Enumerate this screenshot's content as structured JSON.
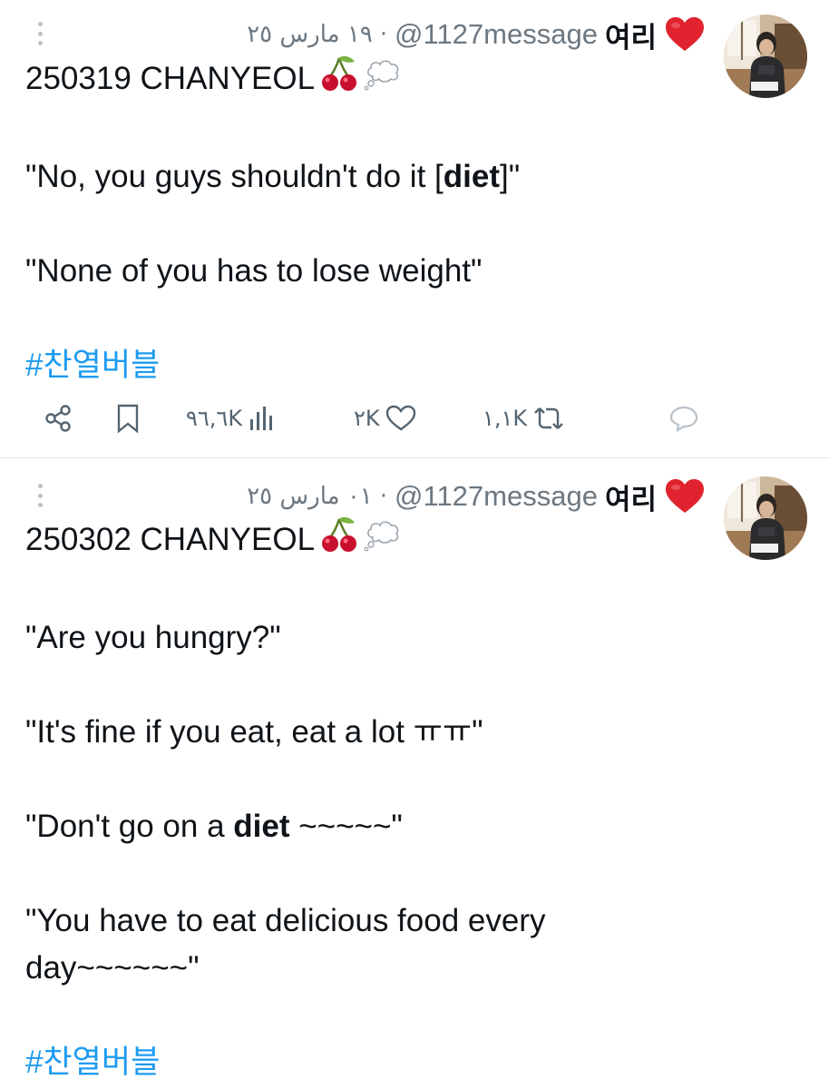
{
  "tweets": [
    {
      "date": "١٩ مارس ٢٥",
      "dot": "·",
      "handle": "@1127message",
      "display_name": "여리",
      "body": {
        "title": "250319 CHANYEOL",
        "lines": [
          [
            "\"No, you guys shouldn't do it [",
            "diet",
            "]\""
          ],
          [
            "\"None of you has to lose weight\""
          ]
        ],
        "hashtag": "#찬열버블"
      },
      "actions": {
        "views": "٩٦,٦K",
        "likes": "٢K",
        "retweets": "١,١K"
      }
    },
    {
      "date": "٠١ مارس ٢٥",
      "dot": "·",
      "handle": "@1127message",
      "display_name": "여리",
      "body": {
        "title": "250302 CHANYEOL",
        "lines": [
          [
            "\"Are you hungry?\""
          ],
          [
            "\"It's fine if you eat, eat a lot ㅠㅠ\""
          ],
          [
            "\"Don't go on a ",
            "diet",
            " ~~~~~\""
          ],
          [
            "\"You have to eat delicious food every",
            "day~~~~~~\""
          ]
        ],
        "hashtag": "#찬열버블"
      }
    }
  ],
  "icons": {
    "more": "more-vertical-icon",
    "share": "share-icon",
    "bookmark": "bookmark-icon",
    "views": "analytics-icon",
    "like": "heart-icon",
    "retweet": "retweet-icon",
    "reply": "reply-icon",
    "heart_emoji": "red-heart-emoji",
    "cherry_emoji": "cherries-emoji",
    "thought_emoji": "thought-balloon-emoji"
  },
  "colors": {
    "accent": "#1d9bf0",
    "muted_text": "#6c7780",
    "divider": "#e1e5e8",
    "heart_red": "#e0232e"
  }
}
